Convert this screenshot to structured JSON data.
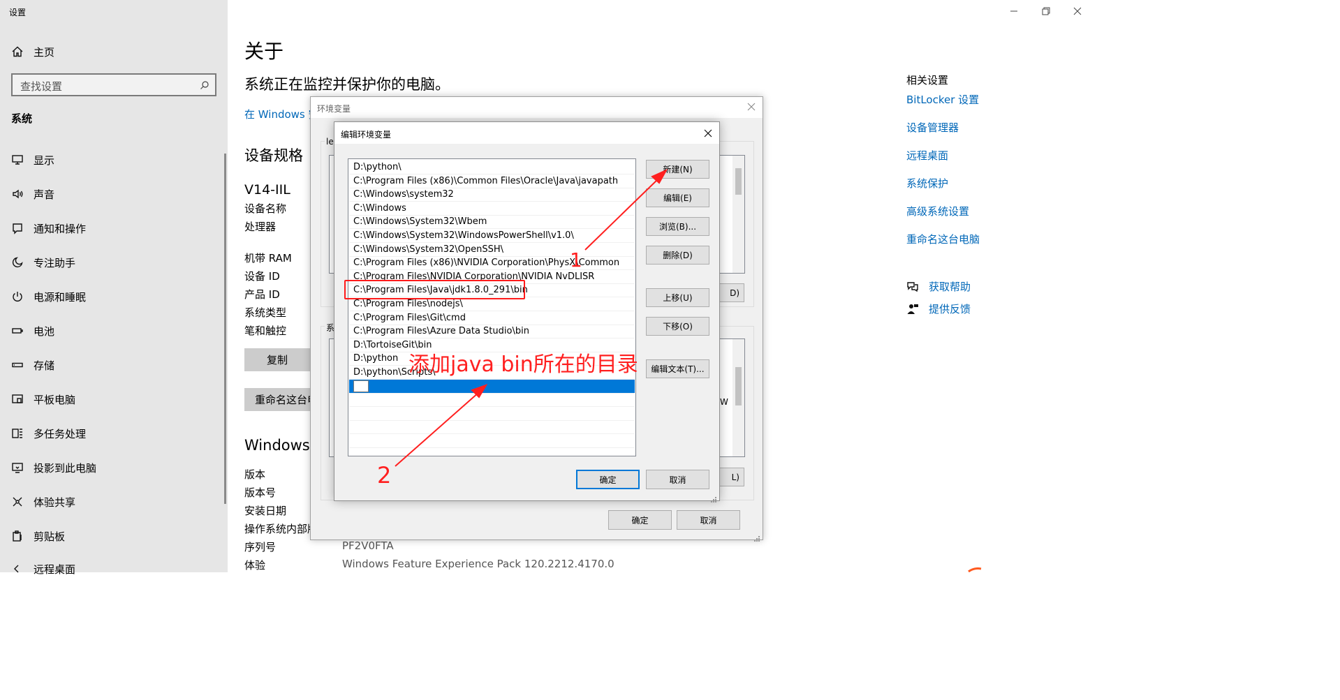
{
  "app": {
    "title": "设置"
  },
  "sidebar": {
    "home_label": "主页",
    "search_placeholder": "查找设置",
    "section_heading": "系统",
    "items": [
      {
        "label": "显示",
        "icon": "monitor-icon"
      },
      {
        "label": "声音",
        "icon": "speaker-icon"
      },
      {
        "label": "通知和操作",
        "icon": "notification-icon"
      },
      {
        "label": "专注助手",
        "icon": "moon-icon"
      },
      {
        "label": "电源和睡眠",
        "icon": "power-icon"
      },
      {
        "label": "电池",
        "icon": "battery-icon"
      },
      {
        "label": "存储",
        "icon": "storage-icon"
      },
      {
        "label": "平板电脑",
        "icon": "tablet-icon"
      },
      {
        "label": "多任务处理",
        "icon": "multitask-icon"
      },
      {
        "label": "投影到此电脑",
        "icon": "projector-icon"
      },
      {
        "label": "体验共享",
        "icon": "share-icon"
      },
      {
        "label": "剪贴板",
        "icon": "clipboard-icon"
      },
      {
        "label": "远程桌面",
        "icon": "remote-desktop-icon"
      }
    ]
  },
  "main": {
    "title": "关于",
    "subtitle": "系统正在监控并保护你的电脑。",
    "security_link": "在 Windows 安",
    "spec_heading": "设备规格",
    "device_model": "V14-IIL",
    "spec_labels": [
      "设备名称",
      "处理器",
      "机带 RAM",
      "设备 ID",
      "产品 ID",
      "系统类型",
      "笔和触控"
    ],
    "copy_button": "复制",
    "rename_button": "重命名这台电",
    "windows_heading": "Windows 规",
    "win_labels": [
      "版本",
      "版本号",
      "安装日期",
      "操作系统内部版",
      "序列号",
      "体验"
    ],
    "serial_value": "PF2V0FTA",
    "experience_value": "Windows Feature Experience Pack 120.2212.4170.0"
  },
  "related": {
    "heading": "相关设置",
    "links": [
      "BitLocker 设置",
      "设备管理器",
      "远程桌面",
      "系统保护",
      "高级系统设置",
      "重命名这台电脑"
    ],
    "help": "获取帮助",
    "feedback": "提供反馈"
  },
  "env_dialog": {
    "title": "环境变量",
    "user_group_fragment": "ler",
    "system_group_fragment": "系",
    "fragment_d": "D)",
    "fragment_w": "W",
    "fragment_l": "L)",
    "ok": "确定",
    "cancel": "取消"
  },
  "edit_dialog": {
    "title": "编辑环境变量",
    "paths": [
      "D:\\python\\",
      "C:\\Program Files (x86)\\Common Files\\Oracle\\Java\\javapath",
      "C:\\Windows\\system32",
      "C:\\Windows",
      "C:\\Windows\\System32\\Wbem",
      "C:\\Windows\\System32\\WindowsPowerShell\\v1.0\\",
      "C:\\Windows\\System32\\OpenSSH\\",
      "C:\\Program Files (x86)\\NVIDIA Corporation\\PhysX\\Common",
      "C:\\Program Files\\NVIDIA Corporation\\NVIDIA NvDLISR",
      "C:\\Program Files\\Java\\jdk1.8.0_291\\bin",
      "C:\\Program Files\\nodejs\\",
      "C:\\Program Files\\Git\\cmd",
      "C:\\Program Files\\Azure Data Studio\\bin",
      "D:\\TortoiseGit\\bin",
      "D:\\python",
      "D:\\python\\Scripts\\"
    ],
    "buttons": {
      "new": "新建(N)",
      "edit": "编辑(E)",
      "browse": "浏览(B)...",
      "delete": "删除(D)",
      "move_up": "上移(U)",
      "move_down": "下移(O)",
      "edit_text": "编辑文本(T)...",
      "ok": "确定",
      "cancel": "取消"
    }
  },
  "annotations": {
    "note": "添加java bin所在的目录",
    "step1": "1",
    "step2": "2",
    "color": "#ff1f1f"
  }
}
